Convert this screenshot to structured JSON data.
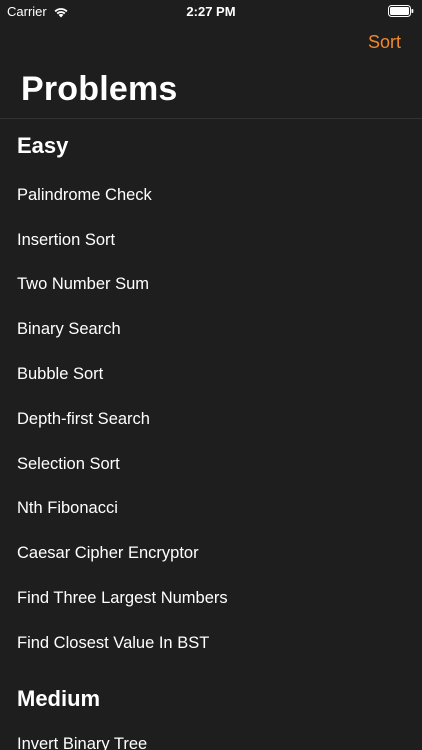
{
  "status_bar": {
    "carrier": "Carrier",
    "time": "2:27 PM"
  },
  "nav": {
    "sort_label": "Sort",
    "title": "Problems"
  },
  "accent_color": "#f0882b",
  "sections": [
    {
      "title": "Easy",
      "items": [
        "Palindrome Check",
        "Insertion Sort",
        "Two Number Sum",
        "Binary Search",
        "Bubble Sort",
        "Depth-first Search",
        "Selection Sort",
        "Nth Fibonacci",
        "Caesar Cipher Encryptor",
        "Find Three Largest Numbers",
        "Find Closest Value In BST"
      ]
    },
    {
      "title": "Medium",
      "items": [
        "Invert Binary Tree"
      ]
    }
  ]
}
